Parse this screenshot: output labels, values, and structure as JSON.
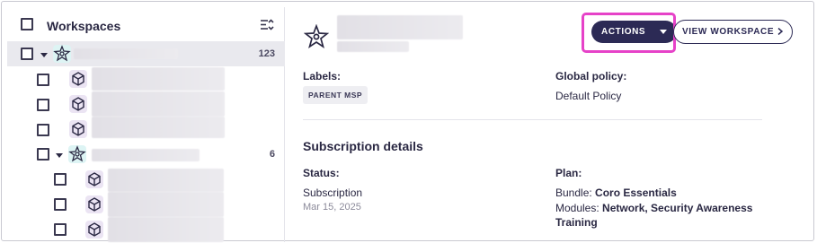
{
  "sidebar": {
    "title": "Workspaces",
    "rows": [
      {
        "count": "123"
      },
      {
        "count": ""
      },
      {
        "count": ""
      },
      {
        "count": ""
      },
      {
        "count": "6"
      },
      {
        "count": ""
      },
      {
        "count": ""
      },
      {
        "count": ""
      }
    ]
  },
  "header": {
    "actions_label": "ACTIONS",
    "view_label": "VIEW WORKSPACE"
  },
  "details": {
    "labels_heading": "Labels:",
    "label_tag": "PARENT MSP",
    "global_policy_heading": "Global policy:",
    "global_policy_value": "Default Policy",
    "subscription_section": "Subscription details",
    "status_heading": "Status:",
    "status_value": "Subscription",
    "status_date": "Mar 15, 2025",
    "plan_heading": "Plan:",
    "bundle_prefix": "Bundle: ",
    "bundle_value": "Coro Essentials",
    "modules_prefix": "Modules: ",
    "modules_value": "Network,  Security Awareness",
    "modules_value_2": "Training"
  },
  "colors": {
    "primary": "#2c2a55",
    "highlight": "#e642c8",
    "selected_row": "#e9e9ee"
  }
}
